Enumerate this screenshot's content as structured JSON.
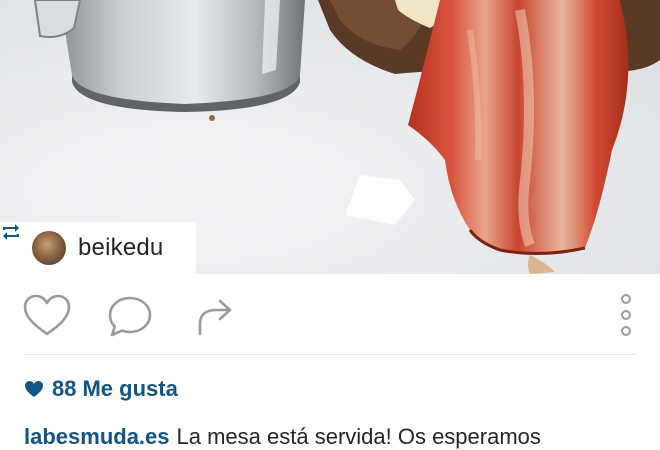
{
  "post": {
    "repost_username": "beikedu",
    "likes_count": "88",
    "likes_label": "Me gusta",
    "caption_username": "labesmuda.es",
    "caption_text": "La mesa está servida! Os esperamos"
  },
  "icons": {
    "repost": "repost-icon",
    "like": "heart-outline-icon",
    "comment": "comment-bubble-icon",
    "share": "share-arrow-icon",
    "more": "vertical-dots-icon",
    "likes_heart": "heart-filled-icon"
  },
  "colors": {
    "link_blue": "#125688",
    "text": "#262626",
    "icon_gray": "#9b9b9b"
  }
}
